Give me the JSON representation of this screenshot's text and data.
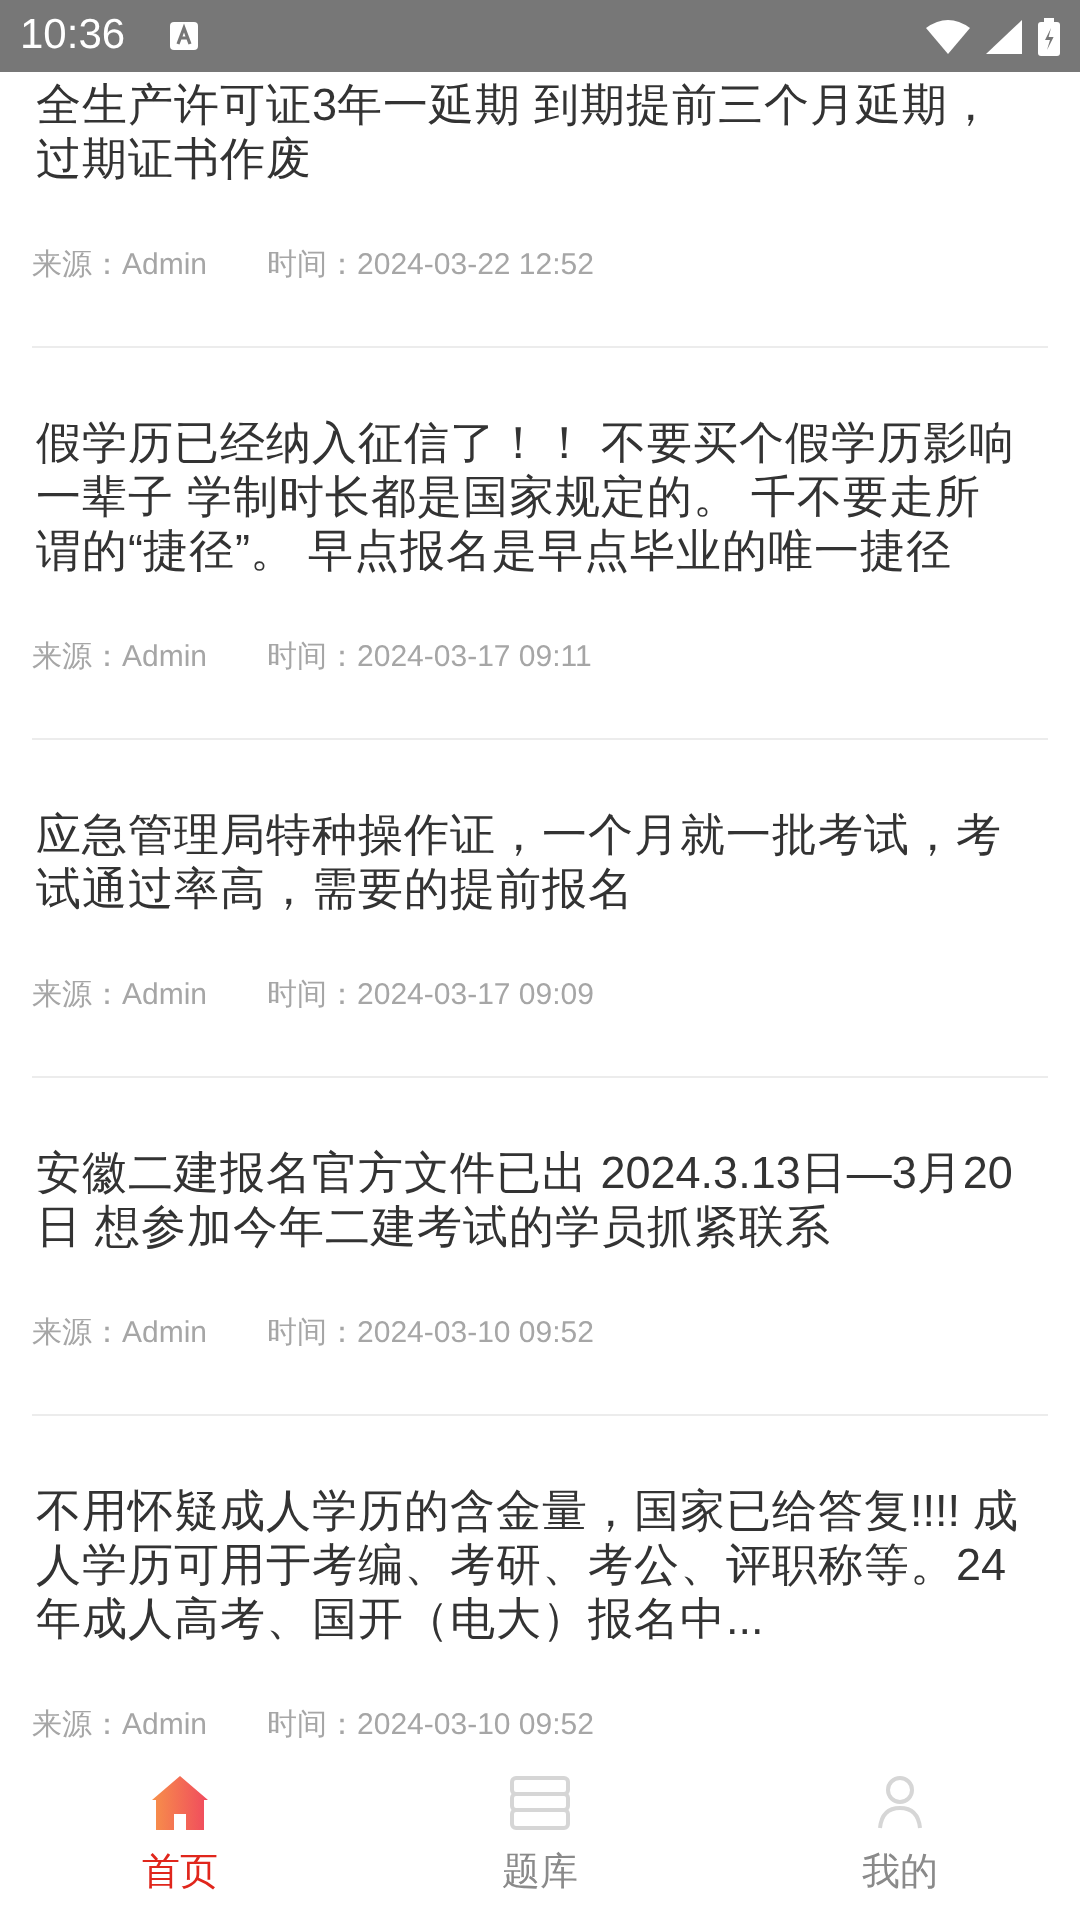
{
  "status_bar": {
    "time": "10:36"
  },
  "articles": [
    {
      "title": "全生产许可证3年一延期 到期提前三个月延期，过期证书作废",
      "source_label": "来源：",
      "source": "Admin",
      "time_label": "时间：",
      "time": "2024-03-22 12:52"
    },
    {
      "title": "假学历已经纳入征信了！！ 不要买个假学历影响一辈子 学制时长都是国家规定的。 千不要走所谓的“捷径”。 早点报名是早点毕业的唯一捷径",
      "source_label": "来源：",
      "source": "Admin",
      "time_label": "时间：",
      "time": "2024-03-17 09:11"
    },
    {
      "title": "应急管理局特种操作证，一个月就一批考试，考试通过率高，需要的提前报名",
      "source_label": "来源：",
      "source": "Admin",
      "time_label": "时间：",
      "time": "2024-03-17 09:09"
    },
    {
      "title": "安徽二建报名官方文件已出 2024.3.13日—3月20日 想参加今年二建考试的学员抓紧联系",
      "source_label": "来源：",
      "source": "Admin",
      "time_label": "时间：",
      "time": "2024-03-10 09:52"
    },
    {
      "title": "不用怀疑成人学历的含金量，国家已给答复!!!! 成人学历可用于考编、考研、考公、评职称等。24年成人高考、国开（电大）报名中...",
      "source_label": "来源：",
      "source": "Admin",
      "time_label": "时间：",
      "time": "2024-03-10 09:52"
    }
  ],
  "tabbar": [
    {
      "kind": "home",
      "label": "首页",
      "selected": true
    },
    {
      "kind": "library",
      "label": "题库",
      "selected": false
    },
    {
      "kind": "profile",
      "label": "我的",
      "selected": false
    }
  ]
}
